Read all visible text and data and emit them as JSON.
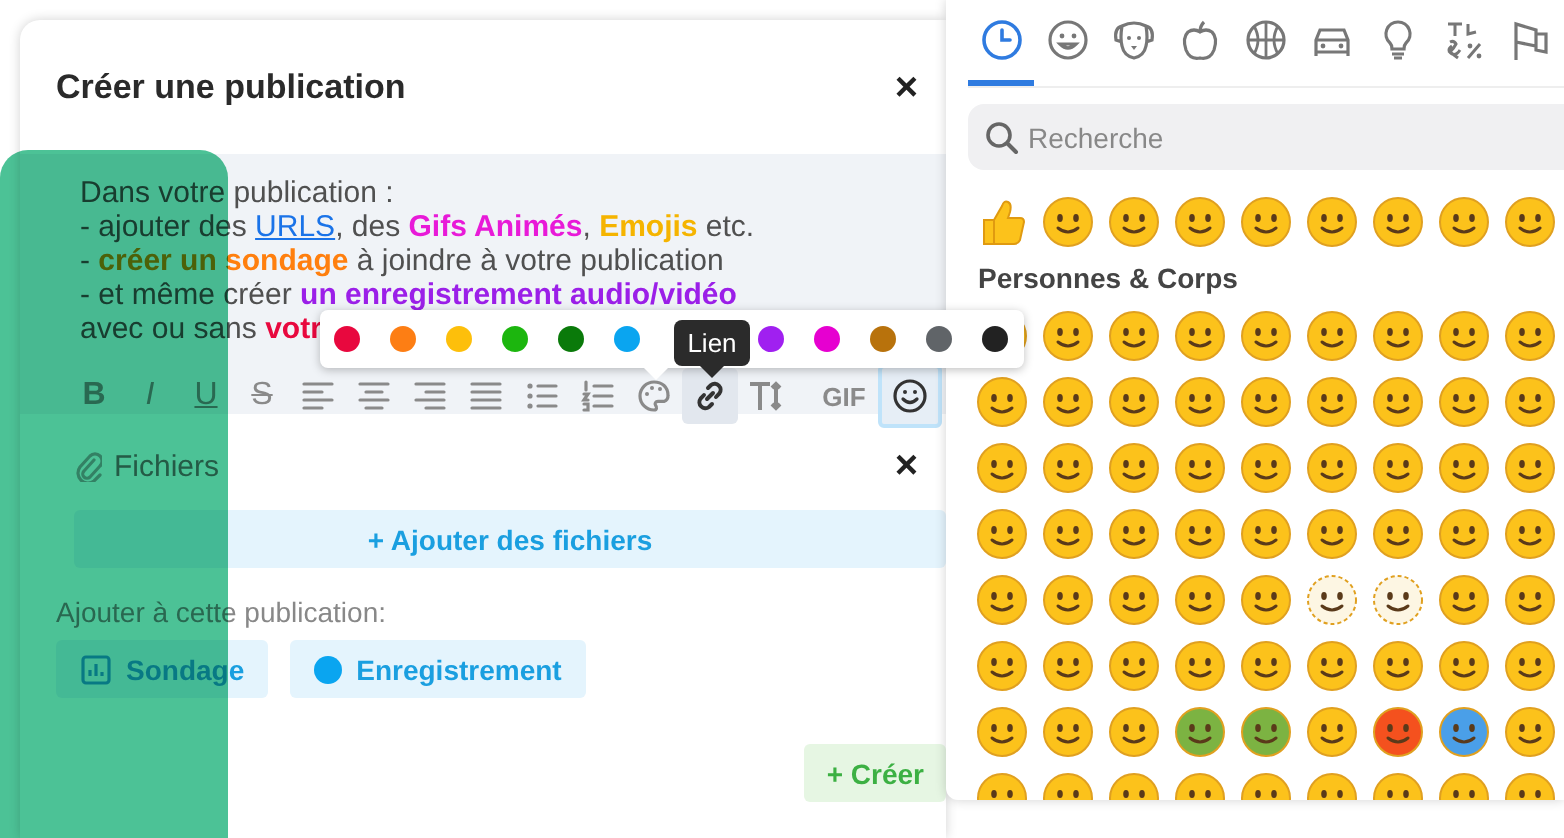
{
  "dialog": {
    "title": "Créer une publication",
    "close": "×"
  },
  "editor": {
    "lines": [
      [
        {
          "text": "Dans votre publication :"
        }
      ],
      [
        {
          "text": "- ajouter des "
        },
        {
          "text": "URLS",
          "kind": "link"
        },
        {
          "text": ", des "
        },
        {
          "text": "Gifs Animés",
          "kind": "bold",
          "color": "#e81ad8"
        },
        {
          "text": ", "
        },
        {
          "text": "Emojis",
          "kind": "bold",
          "color": "#f5b400"
        },
        {
          "text": " etc."
        }
      ],
      [
        {
          "text": "- "
        },
        {
          "text": "créer un sondage",
          "kind": "bold",
          "color": "#ff7f0e"
        },
        {
          "text": " à joindre à votre publication"
        }
      ],
      [
        {
          "text": "- et même créer "
        },
        {
          "text": "un enregistrement audio/vidéo",
          "kind": "bold",
          "color": "#9b1fe8"
        }
      ],
      [
        {
          "text": "avec ou sans "
        },
        {
          "text": "votr",
          "kind": "bold",
          "color": "#e8083e"
        }
      ]
    ],
    "toolbar": [
      {
        "kind": "bold",
        "label": "B",
        "hovered": false,
        "open": false
      },
      {
        "kind": "italic",
        "label": "I",
        "hovered": false,
        "open": false
      },
      {
        "kind": "underline",
        "label": "U",
        "hovered": false,
        "open": false
      },
      {
        "kind": "strike",
        "label": "S",
        "hovered": false,
        "open": false
      },
      {
        "kind": "align-left",
        "hovered": false,
        "open": false
      },
      {
        "kind": "align-center",
        "hovered": false,
        "open": false
      },
      {
        "kind": "align-right",
        "hovered": false,
        "open": false
      },
      {
        "kind": "justify",
        "hovered": false,
        "open": false
      },
      {
        "kind": "bullets",
        "hovered": false,
        "open": false
      },
      {
        "kind": "numbers",
        "hovered": false,
        "open": false
      },
      {
        "kind": "palette",
        "hovered": false,
        "open": false
      },
      {
        "kind": "link",
        "hovered": true,
        "open": false
      },
      {
        "kind": "text-size",
        "hovered": false,
        "open": false
      },
      {
        "kind": "gif",
        "label": "GIF",
        "hovered": false,
        "open": false
      },
      {
        "kind": "emoji",
        "hovered": false,
        "open": true
      }
    ],
    "tooltip": "Lien",
    "colors": [
      {
        "color": "#e8083e"
      },
      {
        "color": "#fd7e14"
      },
      {
        "color": "#fdbf0b"
      },
      {
        "color": "#1cb60e"
      },
      {
        "color": "#0a7a0a"
      },
      {
        "color": "#0aa5f0"
      },
      {
        "color": "#a020f0"
      },
      {
        "color": "#e600d0"
      },
      {
        "color": "#b8720c"
      },
      {
        "color": "#606468"
      },
      {
        "color": "#222222"
      }
    ]
  },
  "files": {
    "label": "Fichiers",
    "close": "×",
    "add_button": "+ Ajouter des fichiers"
  },
  "attach": {
    "label": "Ajouter à cette publication:",
    "buttons": [
      {
        "kind": "poll",
        "label": "Sondage"
      },
      {
        "kind": "record",
        "label": "Enregistrement"
      }
    ]
  },
  "submit": "+ Créer",
  "emoji_panel": {
    "tabs": [
      {
        "kind": "clock",
        "selected": true
      },
      {
        "kind": "smiley",
        "selected": false
      },
      {
        "kind": "dog",
        "selected": false
      },
      {
        "kind": "apple",
        "selected": false
      },
      {
        "kind": "ball",
        "selected": false
      },
      {
        "kind": "car",
        "selected": false
      },
      {
        "kind": "bulb",
        "selected": false
      },
      {
        "kind": "symbols",
        "selected": false
      },
      {
        "kind": "flag",
        "selected": false
      }
    ],
    "search": {
      "placeholder": "Recherche"
    },
    "recent": [
      {
        "kind": "thumb"
      },
      {
        "kind": "face"
      },
      {
        "kind": "face"
      },
      {
        "kind": "face"
      },
      {
        "kind": "face"
      },
      {
        "kind": "face"
      },
      {
        "kind": "face"
      },
      {
        "kind": "face"
      },
      {
        "kind": "face"
      }
    ],
    "section": "Personnes & Corps",
    "rows": [
      [
        {
          "kind": "face"
        },
        {
          "kind": "face"
        },
        {
          "kind": "face"
        },
        {
          "kind": "face"
        },
        {
          "kind": "face"
        },
        {
          "kind": "face"
        },
        {
          "kind": "face"
        },
        {
          "kind": "face"
        },
        {
          "kind": "face"
        }
      ],
      [
        {
          "kind": "face"
        },
        {
          "kind": "face"
        },
        {
          "kind": "face"
        },
        {
          "kind": "face"
        },
        {
          "kind": "face"
        },
        {
          "kind": "face"
        },
        {
          "kind": "face"
        },
        {
          "kind": "face"
        },
        {
          "kind": "face"
        }
      ],
      [
        {
          "kind": "face"
        },
        {
          "kind": "face"
        },
        {
          "kind": "face"
        },
        {
          "kind": "face"
        },
        {
          "kind": "face"
        },
        {
          "kind": "face"
        },
        {
          "kind": "face"
        },
        {
          "kind": "face"
        },
        {
          "kind": "face"
        }
      ],
      [
        {
          "kind": "face"
        },
        {
          "kind": "face"
        },
        {
          "kind": "face"
        },
        {
          "kind": "face"
        },
        {
          "kind": "face"
        },
        {
          "kind": "face"
        },
        {
          "kind": "face"
        },
        {
          "kind": "face"
        },
        {
          "kind": "face"
        }
      ],
      [
        {
          "kind": "face"
        },
        {
          "kind": "face"
        },
        {
          "kind": "face"
        },
        {
          "kind": "face"
        },
        {
          "kind": "face"
        },
        {
          "kind": "pale"
        },
        {
          "kind": "pale"
        },
        {
          "kind": "face"
        },
        {
          "kind": "face"
        }
      ],
      [
        {
          "kind": "face"
        },
        {
          "kind": "face"
        },
        {
          "kind": "face"
        },
        {
          "kind": "face"
        },
        {
          "kind": "face"
        },
        {
          "kind": "face"
        },
        {
          "kind": "face"
        },
        {
          "kind": "face"
        },
        {
          "kind": "face"
        }
      ],
      [
        {
          "kind": "face"
        },
        {
          "kind": "face"
        },
        {
          "kind": "face"
        },
        {
          "kind": "sick"
        },
        {
          "kind": "sick"
        },
        {
          "kind": "face"
        },
        {
          "kind": "hot"
        },
        {
          "kind": "cold"
        },
        {
          "kind": "face"
        }
      ],
      [
        {
          "kind": "face"
        },
        {
          "kind": "face"
        },
        {
          "kind": "face"
        },
        {
          "kind": "face"
        },
        {
          "kind": "face"
        },
        {
          "kind": "face"
        },
        {
          "kind": "face"
        },
        {
          "kind": "face"
        },
        {
          "kind": "face"
        }
      ]
    ]
  }
}
